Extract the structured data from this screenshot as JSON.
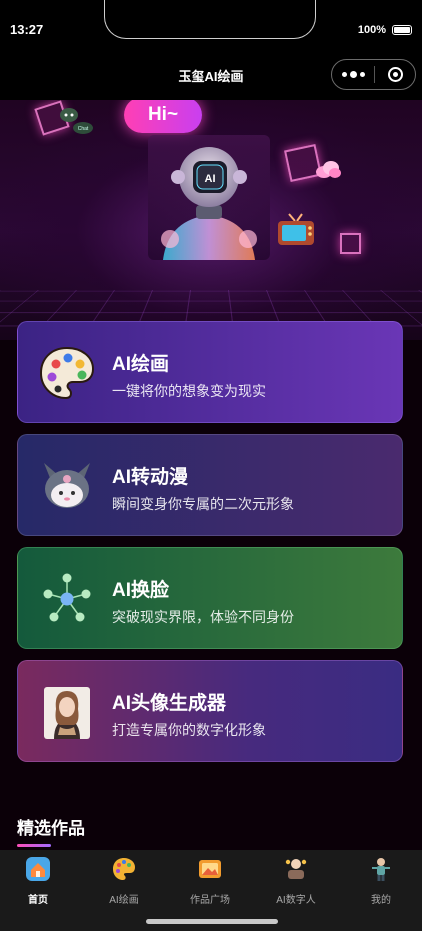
{
  "status_bar": {
    "time": "13:27",
    "battery": "100%"
  },
  "nav": {
    "title": "玉玺AI绘画"
  },
  "hero": {
    "greeting": "Hi~",
    "chat_bubble": "Chat"
  },
  "cards": [
    {
      "title": "AI绘画",
      "subtitle": "一键将你的想象变为现实",
      "icon": "palette-icon"
    },
    {
      "title": "AI转动漫",
      "subtitle": "瞬间变身你专属的二次元形象",
      "icon": "anime-character-icon"
    },
    {
      "title": "AI换脸",
      "subtitle": "突破现实界限，体验不同身份",
      "icon": "network-nodes-icon"
    },
    {
      "title": "AI头像生成器",
      "subtitle": "打造专属你的数字化形象",
      "icon": "avatar-photo-icon"
    }
  ],
  "section": {
    "title": "精选作品"
  },
  "tabs": [
    {
      "label": "首页",
      "icon": "home-icon",
      "active": true
    },
    {
      "label": "AI绘画",
      "icon": "palette-icon",
      "active": false
    },
    {
      "label": "作品广场",
      "icon": "gallery-icon",
      "active": false
    },
    {
      "label": "AI数字人",
      "icon": "digital-human-icon",
      "active": false
    },
    {
      "label": "我的",
      "icon": "profile-icon",
      "active": false
    }
  ],
  "colors": {
    "accent_pink": "#ff3fb4",
    "accent_purple": "#a26bff",
    "tab_bar_bg": "#1a1a1a"
  }
}
